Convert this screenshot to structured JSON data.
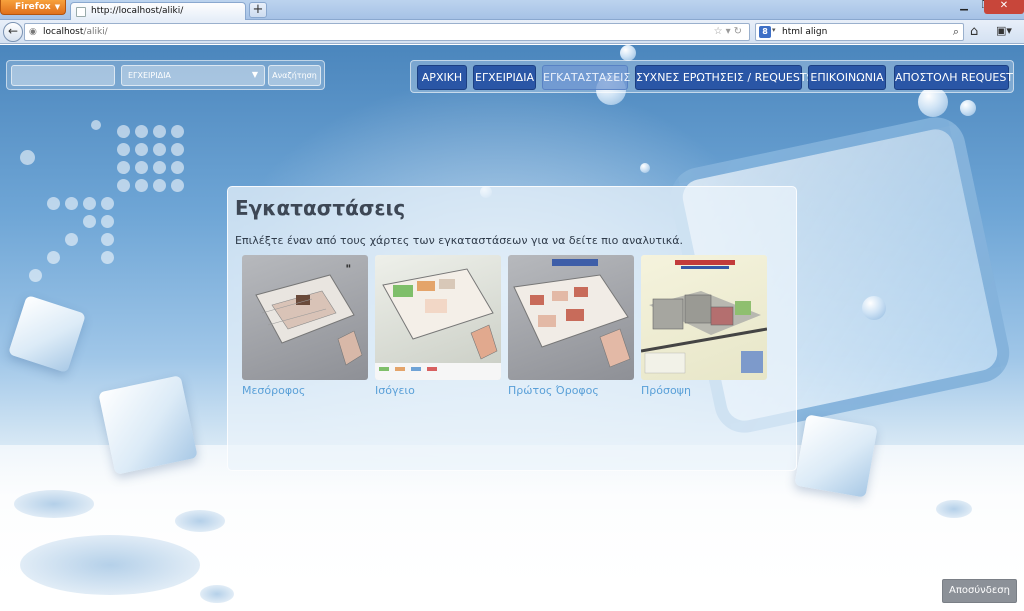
{
  "browser": {
    "firefox_label": "Firefox",
    "tab_title": "http://localhost/aliki/",
    "new_tab": "+",
    "url_host": "localhost",
    "url_path": "/aliki/",
    "search_query": "html align",
    "search_engine_letter": "8"
  },
  "search": {
    "input_value": "",
    "select_value": "ΕΓΧΕΙΡΙΔΙΑ",
    "button_label": "Αναζήτηση"
  },
  "menu": {
    "items": [
      {
        "label": "ΑΡΧΙΚΗ"
      },
      {
        "label": "ΕΓΧΕΙΡΙΔΙΑ"
      },
      {
        "label": "ΕΓΚΑΤΑΣΤΑΣΕΙΣ"
      },
      {
        "label": "ΣΥΧΝΕΣ ΕΡΩΤΗΣΕΙΣ / REQUESTS"
      },
      {
        "label": "ΕΠΙΚΟΙΝΩΝΙΑ"
      },
      {
        "label": "ΑΠΟΣΤΟΛΗ REQUEST"
      }
    ],
    "active_index": 2
  },
  "content": {
    "title": "Εγκαταστάσεις",
    "description": "Επιλέξτε έναν από τους χάρτες των εγκαταστάσεων για να δείτε πιο αναλυτικά.",
    "maps": [
      {
        "caption": "Μεσόροφος"
      },
      {
        "caption": "Ισόγειο"
      },
      {
        "caption": "Πρώτος Όροφος"
      },
      {
        "caption": "Πρόσοψη"
      }
    ]
  },
  "logout_label": "Αποσύνδεση",
  "colors": {
    "menu_button": "#2a56a6",
    "link": "#5aa0d8",
    "firefox_orange": "#e0701c"
  }
}
